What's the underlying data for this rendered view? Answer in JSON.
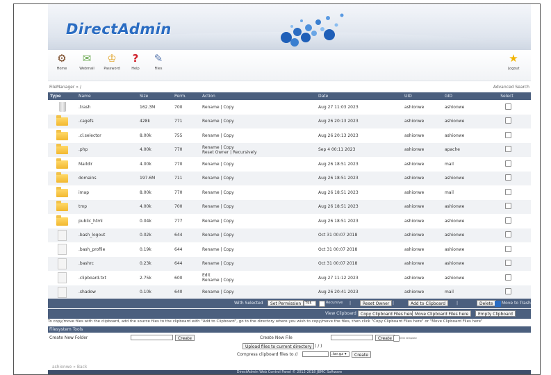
{
  "app": {
    "logo": "DirectAdmin"
  },
  "toolbar": [
    {
      "label": "Home",
      "icon": "home-icon"
    },
    {
      "label": "Webmail",
      "icon": "envelope-icon"
    },
    {
      "label": "Password",
      "icon": "lock-icon"
    },
    {
      "label": "Help",
      "icon": "help-icon"
    },
    {
      "label": "Files",
      "icon": "files-icon"
    },
    {
      "label": "Logout",
      "icon": "star-icon"
    }
  ],
  "breadcrumb": "FileManager » /",
  "advanced_search": "Advanced Search",
  "columns": [
    "Type",
    "Name",
    "Size",
    "Perm.",
    "Action",
    "Date",
    "UID",
    "GID",
    "Select"
  ],
  "files": [
    {
      "icon": "trash-icon",
      "name": ".trash",
      "size": "162.3M",
      "perm": "700",
      "action": "Rename | Copy",
      "date": "Aug 27 11:03 2023",
      "uid": "ashionwe",
      "gid": "ashionwe"
    },
    {
      "icon": "folder-icon",
      "name": ".cagefs",
      "size": "428k",
      "perm": "771",
      "action": "Rename | Copy",
      "date": "Aug 26 20:13 2023",
      "uid": "ashionwe",
      "gid": "ashionwe"
    },
    {
      "icon": "folder-icon",
      "name": ".cl.selector",
      "size": "8.00k",
      "perm": "755",
      "action": "Rename | Copy",
      "date": "Aug 26 20:13 2023",
      "uid": "ashionwe",
      "gid": "ashionwe"
    },
    {
      "icon": "folder-icon",
      "name": ".php",
      "size": "4.00k",
      "perm": "770",
      "action": "Rename | Copy",
      "action2": "Reset Owner | Recursively",
      "date": "Sep 4 00:11 2023",
      "uid": "ashionwe",
      "gid": "apache"
    },
    {
      "icon": "folder-icon",
      "name": "Maildir",
      "size": "4.00k",
      "perm": "770",
      "action": "Rename | Copy",
      "date": "Aug 26 18:51 2023",
      "uid": "ashionwe",
      "gid": "mail"
    },
    {
      "icon": "folder-icon",
      "name": "domains",
      "size": "197.6M",
      "perm": "711",
      "action": "Rename | Copy",
      "date": "Aug 26 18:51 2023",
      "uid": "ashionwe",
      "gid": "ashionwe"
    },
    {
      "icon": "folder-icon",
      "name": "imap",
      "size": "8.00k",
      "perm": "770",
      "action": "Rename | Copy",
      "date": "Aug 26 18:51 2023",
      "uid": "ashionwe",
      "gid": "mail"
    },
    {
      "icon": "folder-icon",
      "name": "tmp",
      "size": "4.00k",
      "perm": "700",
      "action": "Rename | Copy",
      "date": "Aug 26 18:51 2023",
      "uid": "ashionwe",
      "gid": "ashionwe"
    },
    {
      "icon": "folder-link-icon",
      "name": "public_html",
      "size": "0.04k",
      "perm": "777",
      "action": "Rename | Copy",
      "date": "Aug 26 18:51 2023",
      "uid": "ashionwe",
      "gid": "ashionwe"
    },
    {
      "icon": "file-icon",
      "name": ".bash_logout",
      "size": "0.02k",
      "perm": "644",
      "action": "Rename | Copy",
      "date": "Oct 31 00:07 2018",
      "uid": "ashionwe",
      "gid": "ashionwe"
    },
    {
      "icon": "file-icon",
      "name": ".bash_profile",
      "size": "0.19k",
      "perm": "644",
      "action": "Rename | Copy",
      "date": "Oct 31 00:07 2018",
      "uid": "ashionwe",
      "gid": "ashionwe"
    },
    {
      "icon": "file-icon",
      "name": ".bashrc",
      "size": "0.23k",
      "perm": "644",
      "action": "Rename | Copy",
      "date": "Oct 31 00:07 2018",
      "uid": "ashionwe",
      "gid": "ashionwe"
    },
    {
      "icon": "file-icon",
      "name": ".clipboard.txt",
      "size": "2.75k",
      "perm": "600",
      "action": "Edit",
      "action2": "Rename | Copy",
      "date": "Aug 27 11:12 2023",
      "uid": "ashionwe",
      "gid": "ashionwe"
    },
    {
      "icon": "file-icon",
      "name": ".shadow",
      "size": "0.10k",
      "perm": "640",
      "action": "Rename | Copy",
      "date": "Aug 26 20:41 2023",
      "uid": "ashionwe",
      "gid": "mail"
    }
  ],
  "bulk": {
    "with_selected": "With Selected",
    "set_permission": "Set Permission",
    "perm_value": "755",
    "recursive": "Recursive",
    "sep": "|",
    "reset_owner": "Reset Owner",
    "add_to_clipboard": "Add to Clipboard",
    "delete": "Delete",
    "move_to_trash": "Move to Trash"
  },
  "clipboard": {
    "view": "View Clipboard",
    "copy_here": "Copy Clipboard Files here",
    "move_here": "Move Clipboard Files here",
    "empty": "Empty Clipboard"
  },
  "note": "To copy/move files with the clipboard, add the source files to the clipboard with \"Add to Clipboard\", go to the directory where you wish to copy/move the files, then click \"Copy Clipboard Files here\" or \"Move Clipboard Files here\"",
  "fs_tools": {
    "title": "Filesystem Tools",
    "create_folder": "Create New Folder",
    "create_btn": "Create",
    "create_file": "Create New File",
    "html_template": "html template",
    "upload": "Upload files to current directory",
    "upload_path": "( / )",
    "compress_label": "Compress clipboard files to //",
    "compress_ext": ".tar.gz",
    "compress_btn": "Create"
  },
  "back_link": "ashionwe » Back",
  "footer": "DirectAdmin Web Control Panel © 2012-2018 JBMC Software"
}
